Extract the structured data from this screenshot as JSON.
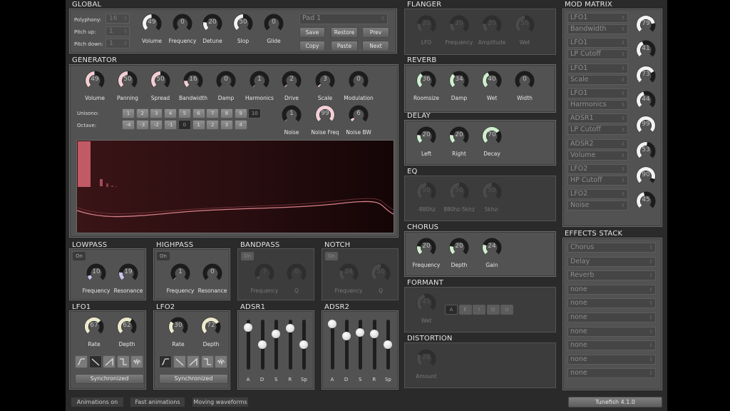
{
  "colors": {
    "generator_accent": "#f3cfd5",
    "lowpass_accent": "#c8c4ef",
    "lfo_accent": "#eceacb",
    "fx_accent": "#cfeecf",
    "mod_accent": "#f2f2f2",
    "disabled_accent": "#4a4a4a",
    "spectrum_bar": "#c25a66"
  },
  "global": {
    "title": "GLOBAL",
    "polyphony": {
      "label": "Polyphony:",
      "value": "16"
    },
    "pitch_up": {
      "label": "Pitch up:",
      "value": "1"
    },
    "pitch_down": {
      "label": "Pitch down:",
      "value": "1"
    },
    "knobs": [
      {
        "label": "Volume",
        "value": 49
      },
      {
        "label": "Frequency",
        "value": 0
      },
      {
        "label": "Detune",
        "value": 20
      },
      {
        "label": "Slop",
        "value": 50
      },
      {
        "label": "Glide",
        "value": 0
      }
    ],
    "preset": {
      "value": "Pad 1"
    },
    "buttons": {
      "save": "Save",
      "restore": "Restore",
      "prev": "Prev",
      "copy": "Copy",
      "paste": "Paste",
      "next": "Next"
    }
  },
  "generator": {
    "title": "GENERATOR",
    "knobs": [
      {
        "label": "Volume",
        "value": 49
      },
      {
        "label": "Panning",
        "value": 50
      },
      {
        "label": "Spread",
        "value": 50
      },
      {
        "label": "Bandwidth",
        "value": 16
      },
      {
        "label": "Damp",
        "value": 0
      },
      {
        "label": "Harmonics",
        "value": 1
      },
      {
        "label": "Drive",
        "value": 2
      },
      {
        "label": "Scale",
        "value": 3
      },
      {
        "label": "Modulation",
        "value": 0
      }
    ],
    "knobs2": [
      {
        "label": "Noise",
        "value": 1
      },
      {
        "label": "Noise Freq",
        "value": 99
      },
      {
        "label": "Noise BW",
        "value": 6
      }
    ],
    "unisono": {
      "label": "Unisono:",
      "options": [
        "1",
        "2",
        "3",
        "4",
        "5",
        "6",
        "7",
        "8",
        "9",
        "10"
      ],
      "selected": "10"
    },
    "octave": {
      "label": "Octave:",
      "options": [
        "-4",
        "-3",
        "-2",
        "-1",
        "0",
        "1",
        "2",
        "3",
        "4"
      ],
      "selected": "0"
    }
  },
  "filters": [
    {
      "title": "LOWPASS",
      "on_label": "On",
      "enabled": true,
      "knobs": [
        {
          "label": "Frequency",
          "value": 10
        },
        {
          "label": "Resonance",
          "value": 19
        }
      ]
    },
    {
      "title": "HIGHPASS",
      "on_label": "On",
      "enabled": true,
      "knobs": [
        {
          "label": "Frequency",
          "value": 1
        },
        {
          "label": "Resonance",
          "value": 0
        }
      ]
    },
    {
      "title": "BANDPASS",
      "on_label": "On",
      "enabled": false,
      "knobs": [
        {
          "label": "Frequency",
          "value": 7
        },
        {
          "label": "Q",
          "value": 0
        }
      ]
    },
    {
      "title": "NOTCH",
      "on_label": "On",
      "enabled": false,
      "knobs": [
        {
          "label": "Frequency",
          "value": 24
        },
        {
          "label": "Q",
          "value": 50
        }
      ]
    }
  ],
  "lfos": [
    {
      "title": "LFO1",
      "knobs": [
        {
          "label": "Rate",
          "value": 67
        },
        {
          "label": "Depth",
          "value": 62
        }
      ],
      "waveforms": [
        "sine",
        "saw-down",
        "saw-up",
        "square",
        "noise"
      ],
      "selected_waveform": "saw-down",
      "sync_label": "Synchronized"
    },
    {
      "title": "LFO2",
      "knobs": [
        {
          "label": "Rate",
          "value": 30
        },
        {
          "label": "Depth",
          "value": 72
        }
      ],
      "waveforms": [
        "sine",
        "saw-down",
        "saw-up",
        "square",
        "noise"
      ],
      "selected_waveform": "sine",
      "sync_label": "Synchronized"
    }
  ],
  "adsrs": [
    {
      "title": "ADSR1",
      "sliders": [
        {
          "label": "A",
          "value": 0.88
        },
        {
          "label": "D",
          "value": 0.5
        },
        {
          "label": "S",
          "value": 0.75
        },
        {
          "label": "R",
          "value": 0.87
        },
        {
          "label": "Sp",
          "value": 0.5
        }
      ]
    },
    {
      "title": "ADSR2",
      "sliders": [
        {
          "label": "A",
          "value": 0.97
        },
        {
          "label": "D",
          "value": 0.69
        },
        {
          "label": "S",
          "value": 0.78
        },
        {
          "label": "R",
          "value": 0.74
        },
        {
          "label": "Sp",
          "value": 0.5
        }
      ]
    }
  ],
  "fx": {
    "flanger": {
      "title": "FLANGER",
      "enabled": false,
      "knobs": [
        {
          "label": "LFO",
          "value": 20
        },
        {
          "label": "Frequency",
          "value": 20
        },
        {
          "label": "Amplitude",
          "value": 20
        },
        {
          "label": "Wet",
          "value": 50
        }
      ]
    },
    "reverb": {
      "title": "REVERB",
      "enabled": true,
      "knobs": [
        {
          "label": "Roomsize",
          "value": 36
        },
        {
          "label": "Damp",
          "value": 34
        },
        {
          "label": "Wet",
          "value": 40
        },
        {
          "label": "Width",
          "value": 0
        }
      ]
    },
    "delay": {
      "title": "DELAY",
      "enabled": true,
      "knobs": [
        {
          "label": "Left",
          "value": 20
        },
        {
          "label": "Right",
          "value": 20
        },
        {
          "label": "Decay",
          "value": 70
        }
      ]
    },
    "eq": {
      "title": "EQ",
      "enabled": false,
      "knobs": [
        {
          "label": "-880hz",
          "value": 50
        },
        {
          "label": "880hz-5khz",
          "value": 50
        },
        {
          "label": "5khz-",
          "value": 50
        }
      ]
    },
    "chorus": {
      "title": "CHORUS",
      "enabled": true,
      "knobs": [
        {
          "label": "Frequency",
          "value": 20
        },
        {
          "label": "Depth",
          "value": 20
        },
        {
          "label": "Gain",
          "value": 24
        }
      ]
    },
    "formant": {
      "title": "FORMANT",
      "enabled": false,
      "knobs": [
        {
          "label": "Wet",
          "value": 45
        }
      ],
      "vowels": [
        "A",
        "E",
        "I",
        "O",
        "U"
      ],
      "selected_vowel": "A"
    },
    "distortion": {
      "title": "DISTORTION",
      "enabled": false,
      "knobs": [
        {
          "label": "Amount",
          "value": 28
        }
      ]
    }
  },
  "mod_matrix": {
    "title": "MOD MATRIX",
    "slots": [
      {
        "source": "LFO1",
        "target": "Bandwidth",
        "amount": 79
      },
      {
        "source": "LFO1",
        "target": "LP Cutoff",
        "amount": 41
      },
      {
        "source": "LFO1",
        "target": "Scale",
        "amount": 73
      },
      {
        "source": "LFO1",
        "target": "Harmonics",
        "amount": 44
      },
      {
        "source": "ADSR1",
        "target": "LP Cutoff",
        "amount": 99
      },
      {
        "source": "ADSR2",
        "target": "Volume",
        "amount": 53
      },
      {
        "source": "LFO2",
        "target": "HP Cutoff",
        "amount": 90
      },
      {
        "source": "LFO2",
        "target": "Noise",
        "amount": 45
      }
    ]
  },
  "effects_stack": {
    "title": "EFFECTS STACK",
    "items": [
      "Chorus",
      "Delay",
      "Reverb",
      "none",
      "none",
      "none",
      "none",
      "none",
      "none",
      "none"
    ]
  },
  "footer": {
    "animations": "Animations on",
    "fast": "Fast animations",
    "moving": "Moving waveforms",
    "version": "Tunefish 4.1.0"
  }
}
